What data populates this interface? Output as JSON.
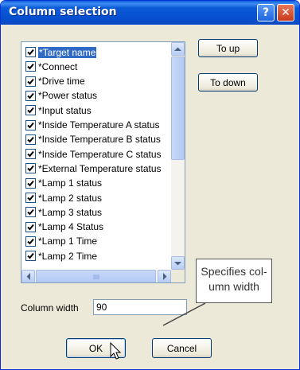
{
  "window": {
    "title": "Column selection",
    "help_label": "?",
    "close_label": "✕"
  },
  "list": {
    "items": [
      {
        "label": "*Target name",
        "checked": true,
        "selected": true
      },
      {
        "label": "*Connect",
        "checked": true
      },
      {
        "label": "*Drive time",
        "checked": true
      },
      {
        "label": "*Power status",
        "checked": true
      },
      {
        "label": "*Input status",
        "checked": true
      },
      {
        "label": "*Inside Temperature A status",
        "checked": true
      },
      {
        "label": "*Inside Temperature B status",
        "checked": true
      },
      {
        "label": "*Inside Temperature C status",
        "checked": true
      },
      {
        "label": "*External Temperature status",
        "checked": true
      },
      {
        "label": "*Lamp 1 status",
        "checked": true
      },
      {
        "label": "*Lamp 2 status",
        "checked": true
      },
      {
        "label": "*Lamp 3 status",
        "checked": true
      },
      {
        "label": "*Lamp 4 Status",
        "checked": true
      },
      {
        "label": "*Lamp 1 Time",
        "checked": true
      },
      {
        "label": "*Lamp 2 Time",
        "checked": true
      }
    ]
  },
  "buttons": {
    "to_up": "To up",
    "to_down": "To down",
    "ok": "OK",
    "cancel": "Cancel"
  },
  "column_width": {
    "label": "Column width",
    "value": "90"
  },
  "callout": {
    "line1": "Specifies col-",
    "line2": "umn width"
  }
}
